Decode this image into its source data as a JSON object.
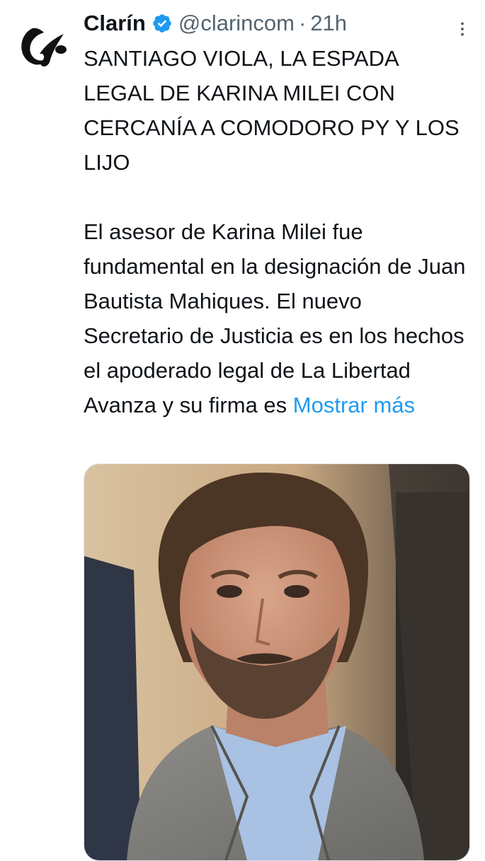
{
  "tweet": {
    "display_name": "Clarín",
    "handle": "@clarincom",
    "separator": "·",
    "time": "21h",
    "headline": "SANTIAGO VIOLA, LA ESPADA LEGAL DE KARINA MILEI CON CERCANÍA A COMODORO PY Y LOS LIJO",
    "body": "El asesor de Karina Milei fue fundamental en la designación de Juan Bautista Mahiques. El nuevo Secretario de Justicia es en los hechos el apoderado legal de La Libertad Avanza y su firma es",
    "show_more": "Mostrar más",
    "verified": true
  },
  "icons": {
    "avatar": "clarin-logo-icon",
    "verified": "verified-badge-icon",
    "more": "more-options-icon"
  },
  "colors": {
    "text": "#0f1419",
    "secondary": "#536471",
    "link": "#1d9bf0",
    "verified": "#1d9bf0"
  }
}
